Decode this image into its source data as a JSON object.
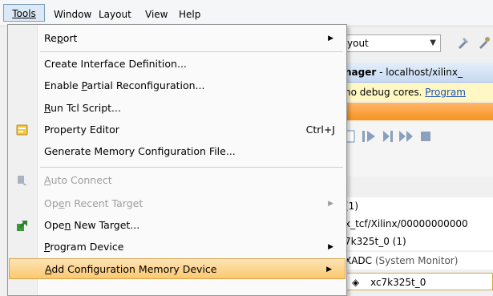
{
  "menubar": {
    "items": [
      {
        "label": "Tools"
      },
      {
        "label": "Window"
      },
      {
        "label": "Layout"
      },
      {
        "label": "View"
      },
      {
        "label": "Help"
      }
    ]
  },
  "background": {
    "layout_combo": "yout",
    "hw_manager_title": "nager",
    "hw_manager_host": " - localhost/xilinx_",
    "info_text": "no debug cores. ",
    "info_link": "Program",
    "tree": [
      {
        "text": "(1)"
      },
      {
        "text": "x_tcf/Xilinx/00000000000"
      },
      {
        "text": "7k325t_0 (1)"
      },
      {
        "text": "XADC",
        "suffix": " (System Monitor)"
      },
      {
        "text": "xc7k325t_0"
      }
    ]
  },
  "menu": {
    "items": [
      {
        "label": "Report",
        "submenu": true
      },
      {
        "label": "Create Interface Definition..."
      },
      {
        "label": "Enable Partial Reconfiguration..."
      },
      {
        "label": "Run Tcl Script..."
      },
      {
        "label": "Property Editor",
        "shortcut": "Ctrl+J",
        "icon": "property-editor-icon"
      },
      {
        "label": "Generate Memory Configuration File..."
      },
      {
        "label": "Auto Connect",
        "disabled": true,
        "icon": "auto-connect-icon"
      },
      {
        "label": "Open Recent Target",
        "disabled": true,
        "submenu": true
      },
      {
        "label": "Open New Target...",
        "icon": "open-target-icon"
      },
      {
        "label": "Program Device",
        "submenu": true
      },
      {
        "label": "Add Configuration Memory Device",
        "submenu": true,
        "highlighted": true
      }
    ],
    "submenu_arrow": "▶"
  },
  "colors": {
    "highlight": "#fbc970",
    "orange_bar": "#f7931e",
    "link": "#1a4fb5"
  }
}
